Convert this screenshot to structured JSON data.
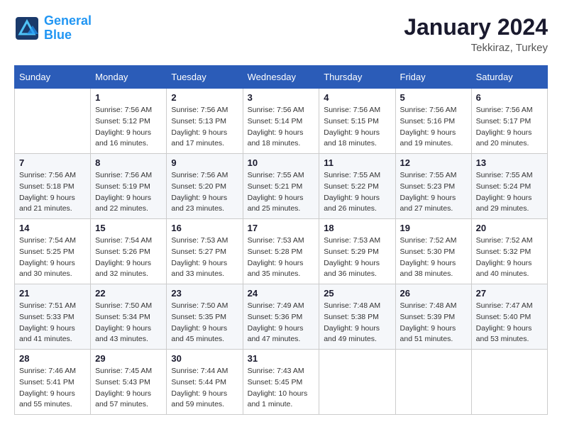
{
  "header": {
    "logo_line1": "General",
    "logo_line2": "Blue",
    "month_year": "January 2024",
    "location": "Tekkiraz, Turkey"
  },
  "columns": [
    "Sunday",
    "Monday",
    "Tuesday",
    "Wednesday",
    "Thursday",
    "Friday",
    "Saturday"
  ],
  "weeks": [
    [
      {
        "day": "",
        "sunrise": "",
        "sunset": "",
        "daylight": ""
      },
      {
        "day": "1",
        "sunrise": "Sunrise: 7:56 AM",
        "sunset": "Sunset: 5:12 PM",
        "daylight": "Daylight: 9 hours and 16 minutes."
      },
      {
        "day": "2",
        "sunrise": "Sunrise: 7:56 AM",
        "sunset": "Sunset: 5:13 PM",
        "daylight": "Daylight: 9 hours and 17 minutes."
      },
      {
        "day": "3",
        "sunrise": "Sunrise: 7:56 AM",
        "sunset": "Sunset: 5:14 PM",
        "daylight": "Daylight: 9 hours and 18 minutes."
      },
      {
        "day": "4",
        "sunrise": "Sunrise: 7:56 AM",
        "sunset": "Sunset: 5:15 PM",
        "daylight": "Daylight: 9 hours and 18 minutes."
      },
      {
        "day": "5",
        "sunrise": "Sunrise: 7:56 AM",
        "sunset": "Sunset: 5:16 PM",
        "daylight": "Daylight: 9 hours and 19 minutes."
      },
      {
        "day": "6",
        "sunrise": "Sunrise: 7:56 AM",
        "sunset": "Sunset: 5:17 PM",
        "daylight": "Daylight: 9 hours and 20 minutes."
      }
    ],
    [
      {
        "day": "7",
        "sunrise": "Sunrise: 7:56 AM",
        "sunset": "Sunset: 5:18 PM",
        "daylight": "Daylight: 9 hours and 21 minutes."
      },
      {
        "day": "8",
        "sunrise": "Sunrise: 7:56 AM",
        "sunset": "Sunset: 5:19 PM",
        "daylight": "Daylight: 9 hours and 22 minutes."
      },
      {
        "day": "9",
        "sunrise": "Sunrise: 7:56 AM",
        "sunset": "Sunset: 5:20 PM",
        "daylight": "Daylight: 9 hours and 23 minutes."
      },
      {
        "day": "10",
        "sunrise": "Sunrise: 7:55 AM",
        "sunset": "Sunset: 5:21 PM",
        "daylight": "Daylight: 9 hours and 25 minutes."
      },
      {
        "day": "11",
        "sunrise": "Sunrise: 7:55 AM",
        "sunset": "Sunset: 5:22 PM",
        "daylight": "Daylight: 9 hours and 26 minutes."
      },
      {
        "day": "12",
        "sunrise": "Sunrise: 7:55 AM",
        "sunset": "Sunset: 5:23 PM",
        "daylight": "Daylight: 9 hours and 27 minutes."
      },
      {
        "day": "13",
        "sunrise": "Sunrise: 7:55 AM",
        "sunset": "Sunset: 5:24 PM",
        "daylight": "Daylight: 9 hours and 29 minutes."
      }
    ],
    [
      {
        "day": "14",
        "sunrise": "Sunrise: 7:54 AM",
        "sunset": "Sunset: 5:25 PM",
        "daylight": "Daylight: 9 hours and 30 minutes."
      },
      {
        "day": "15",
        "sunrise": "Sunrise: 7:54 AM",
        "sunset": "Sunset: 5:26 PM",
        "daylight": "Daylight: 9 hours and 32 minutes."
      },
      {
        "day": "16",
        "sunrise": "Sunrise: 7:53 AM",
        "sunset": "Sunset: 5:27 PM",
        "daylight": "Daylight: 9 hours and 33 minutes."
      },
      {
        "day": "17",
        "sunrise": "Sunrise: 7:53 AM",
        "sunset": "Sunset: 5:28 PM",
        "daylight": "Daylight: 9 hours and 35 minutes."
      },
      {
        "day": "18",
        "sunrise": "Sunrise: 7:53 AM",
        "sunset": "Sunset: 5:29 PM",
        "daylight": "Daylight: 9 hours and 36 minutes."
      },
      {
        "day": "19",
        "sunrise": "Sunrise: 7:52 AM",
        "sunset": "Sunset: 5:30 PM",
        "daylight": "Daylight: 9 hours and 38 minutes."
      },
      {
        "day": "20",
        "sunrise": "Sunrise: 7:52 AM",
        "sunset": "Sunset: 5:32 PM",
        "daylight": "Daylight: 9 hours and 40 minutes."
      }
    ],
    [
      {
        "day": "21",
        "sunrise": "Sunrise: 7:51 AM",
        "sunset": "Sunset: 5:33 PM",
        "daylight": "Daylight: 9 hours and 41 minutes."
      },
      {
        "day": "22",
        "sunrise": "Sunrise: 7:50 AM",
        "sunset": "Sunset: 5:34 PM",
        "daylight": "Daylight: 9 hours and 43 minutes."
      },
      {
        "day": "23",
        "sunrise": "Sunrise: 7:50 AM",
        "sunset": "Sunset: 5:35 PM",
        "daylight": "Daylight: 9 hours and 45 minutes."
      },
      {
        "day": "24",
        "sunrise": "Sunrise: 7:49 AM",
        "sunset": "Sunset: 5:36 PM",
        "daylight": "Daylight: 9 hours and 47 minutes."
      },
      {
        "day": "25",
        "sunrise": "Sunrise: 7:48 AM",
        "sunset": "Sunset: 5:38 PM",
        "daylight": "Daylight: 9 hours and 49 minutes."
      },
      {
        "day": "26",
        "sunrise": "Sunrise: 7:48 AM",
        "sunset": "Sunset: 5:39 PM",
        "daylight": "Daylight: 9 hours and 51 minutes."
      },
      {
        "day": "27",
        "sunrise": "Sunrise: 7:47 AM",
        "sunset": "Sunset: 5:40 PM",
        "daylight": "Daylight: 9 hours and 53 minutes."
      }
    ],
    [
      {
        "day": "28",
        "sunrise": "Sunrise: 7:46 AM",
        "sunset": "Sunset: 5:41 PM",
        "daylight": "Daylight: 9 hours and 55 minutes."
      },
      {
        "day": "29",
        "sunrise": "Sunrise: 7:45 AM",
        "sunset": "Sunset: 5:43 PM",
        "daylight": "Daylight: 9 hours and 57 minutes."
      },
      {
        "day": "30",
        "sunrise": "Sunrise: 7:44 AM",
        "sunset": "Sunset: 5:44 PM",
        "daylight": "Daylight: 9 hours and 59 minutes."
      },
      {
        "day": "31",
        "sunrise": "Sunrise: 7:43 AM",
        "sunset": "Sunset: 5:45 PM",
        "daylight": "Daylight: 10 hours and 1 minute."
      },
      {
        "day": "",
        "sunrise": "",
        "sunset": "",
        "daylight": ""
      },
      {
        "day": "",
        "sunrise": "",
        "sunset": "",
        "daylight": ""
      },
      {
        "day": "",
        "sunrise": "",
        "sunset": "",
        "daylight": ""
      }
    ]
  ]
}
